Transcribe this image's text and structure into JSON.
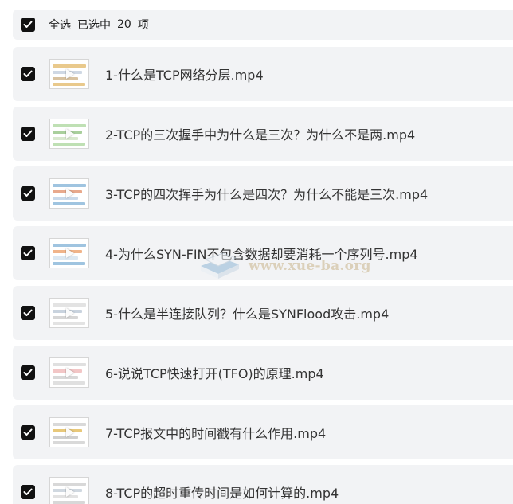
{
  "header": {
    "select_all_label": "全选",
    "selected_label": "已选中",
    "selected_count": "20",
    "unit_label": "项"
  },
  "items": [
    {
      "title": "1-什么是TCP网络分层.mp4",
      "checked": true
    },
    {
      "title": "2-TCP的三次握手中为什么是三次？为什么不是两.mp4",
      "checked": true
    },
    {
      "title": "3-TCP的四次挥手为什么是四次？为什么不能是三次.mp4",
      "checked": true
    },
    {
      "title": "4-为什么SYN-FIN不包含数据却要消耗一个序列号.mp4",
      "checked": true
    },
    {
      "title": "5-什么是半连接队列？什么是SYNFlood攻击.mp4",
      "checked": true
    },
    {
      "title": "6-说说TCP快速打开(TFO)的原理.mp4",
      "checked": true
    },
    {
      "title": "7-TCP报文中的时间戳有什么作用.mp4",
      "checked": true
    },
    {
      "title": "8-TCP的超时重传时间是如何计算的.mp4",
      "checked": true
    }
  ],
  "watermark": {
    "text": "www.xue-ba.org"
  },
  "colors": {
    "row_background": "#f2f3f5",
    "checkbox": "#111111",
    "text": "#333333"
  }
}
